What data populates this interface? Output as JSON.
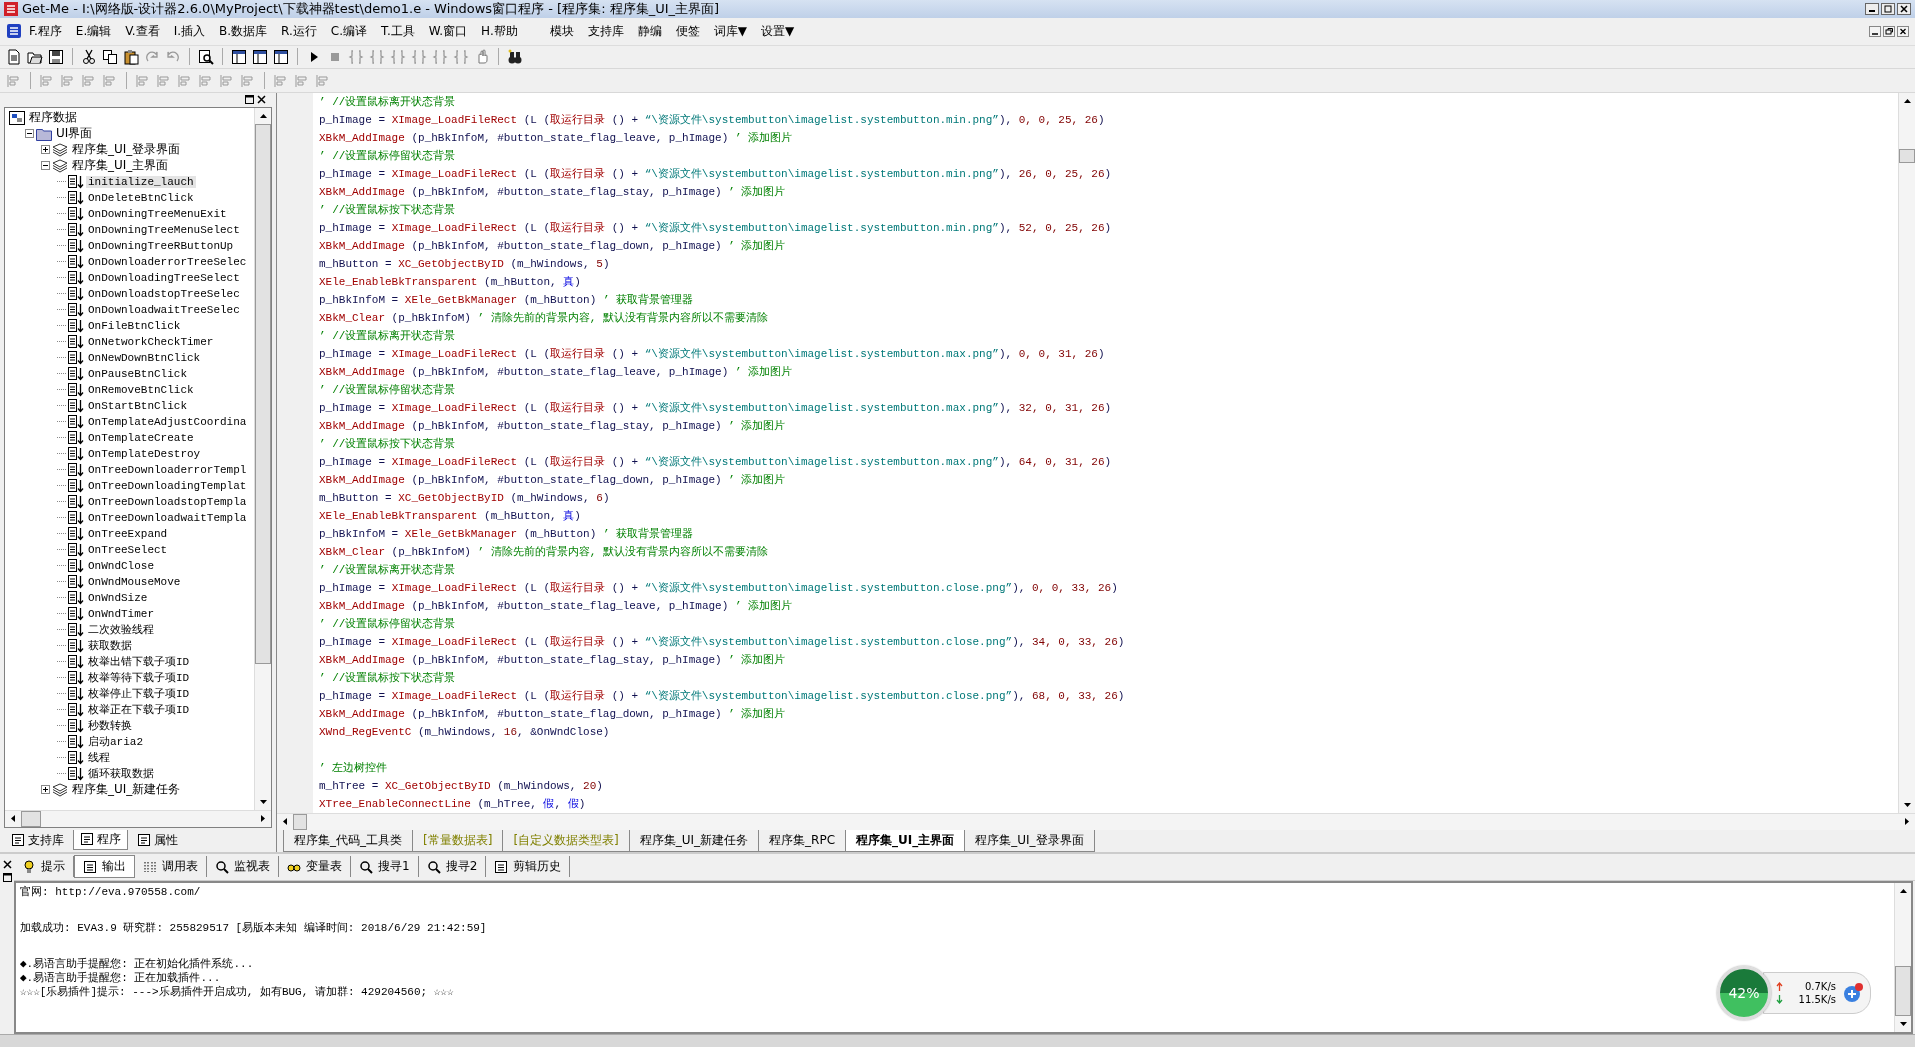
{
  "window": {
    "title": "Get-Me - I:\\网络版-设计器2.6.0\\MyProject\\下载神器test\\demo1.e - Windows窗口程序 - [程序集: 程序集_UI_主界面]"
  },
  "menu": [
    "F.程序",
    "E.编辑",
    "V.查看",
    "I.插入",
    "B.数据库",
    "R.运行",
    "C.编译",
    "T.工具",
    "W.窗口",
    "H.帮助",
    "模块",
    "支持库",
    "静编",
    "便签",
    "词库▼",
    "设置▼"
  ],
  "tree": {
    "root": {
      "label": "程序数据",
      "kind": "root",
      "children": [
        {
          "label": "UI界面",
          "kind": "folder",
          "expanded": true,
          "children": [
            {
              "label": "程序集_UI_登录界面",
              "kind": "module",
              "expanded": false
            },
            {
              "label": "程序集_UI_主界面",
              "kind": "module",
              "expanded": true,
              "children": [
                {
                  "label": "initialize_lauch",
                  "kind": "method",
                  "selected": true
                },
                {
                  "label": "OnDeleteBtnClick",
                  "kind": "method",
                  "selected": false
                },
                {
                  "label": "OnDowningTreeMenuExit",
                  "kind": "method",
                  "selected": false
                },
                {
                  "label": "OnDowningTreeMenuSelect",
                  "kind": "method",
                  "selected": false
                },
                {
                  "label": "OnDowningTreeRButtonUp",
                  "kind": "method",
                  "selected": false
                },
                {
                  "label": "OnDownloaderrorTreeSelec",
                  "kind": "method",
                  "selected": false
                },
                {
                  "label": "OnDownloadingTreeSelect",
                  "kind": "method",
                  "selected": false
                },
                {
                  "label": "OnDownloadstopTreeSelec",
                  "kind": "method",
                  "selected": false
                },
                {
                  "label": "OnDownloadwaitTreeSelec",
                  "kind": "method",
                  "selected": false
                },
                {
                  "label": "OnFileBtnClick",
                  "kind": "method",
                  "selected": false
                },
                {
                  "label": "OnNetworkCheckTimer",
                  "kind": "method",
                  "selected": false
                },
                {
                  "label": "OnNewDownBtnClick",
                  "kind": "method",
                  "selected": false
                },
                {
                  "label": "OnPauseBtnClick",
                  "kind": "method",
                  "selected": false
                },
                {
                  "label": "OnRemoveBtnClick",
                  "kind": "method",
                  "selected": false
                },
                {
                  "label": "OnStartBtnClick",
                  "kind": "method",
                  "selected": false
                },
                {
                  "label": "OnTemplateAdjustCoordina",
                  "kind": "method",
                  "selected": false
                },
                {
                  "label": "OnTemplateCreate",
                  "kind": "method",
                  "selected": false
                },
                {
                  "label": "OnTemplateDestroy",
                  "kind": "method",
                  "selected": false
                },
                {
                  "label": "OnTreeDownloaderrorTempl",
                  "kind": "method",
                  "selected": false
                },
                {
                  "label": "OnTreeDownloadingTemplat",
                  "kind": "method",
                  "selected": false
                },
                {
                  "label": "OnTreeDownloadstopTempla",
                  "kind": "method",
                  "selected": false
                },
                {
                  "label": "OnTreeDownloadwaitTempla",
                  "kind": "method",
                  "selected": false
                },
                {
                  "label": "OnTreeExpand",
                  "kind": "method",
                  "selected": false
                },
                {
                  "label": "OnTreeSelect",
                  "kind": "method",
                  "selected": false
                },
                {
                  "label": "OnWndClose",
                  "kind": "method",
                  "selected": false
                },
                {
                  "label": "OnWndMouseMove",
                  "kind": "method",
                  "selected": false
                },
                {
                  "label": "OnWndSize",
                  "kind": "method",
                  "selected": false
                },
                {
                  "label": "OnWndTimer",
                  "kind": "method",
                  "selected": false
                },
                {
                  "label": "二次效验线程",
                  "kind": "method",
                  "selected": false
                },
                {
                  "label": "获取数据",
                  "kind": "method",
                  "selected": false
                },
                {
                  "label": "枚举出错下载子项ID",
                  "kind": "method",
                  "selected": false
                },
                {
                  "label": "枚举等待下载子项ID",
                  "kind": "method",
                  "selected": false
                },
                {
                  "label": "枚举停止下载子项ID",
                  "kind": "method",
                  "selected": false
                },
                {
                  "label": "枚举正在下载子项ID",
                  "kind": "method",
                  "selected": false
                },
                {
                  "label": "秒数转换",
                  "kind": "method",
                  "selected": false
                },
                {
                  "label": "启动aria2",
                  "kind": "method",
                  "selected": false
                },
                {
                  "label": "线程",
                  "kind": "method",
                  "selected": false
                },
                {
                  "label": "循环获取数据",
                  "kind": "method",
                  "selected": false
                }
              ]
            },
            {
              "label": "程序集_UI_新建任务",
              "kind": "module",
              "expanded": false
            }
          ]
        }
      ]
    }
  },
  "left_tabs": [
    {
      "label": "支持库",
      "selected": false
    },
    {
      "label": "程序",
      "selected": true
    },
    {
      "label": "属性",
      "selected": false
    }
  ],
  "code": [
    {
      "spaced": false,
      "tokens": [
        {
          "kind": "comment",
          "text": "’ //设置鼠标离开状态背景"
        }
      ]
    },
    {
      "spaced": false,
      "tokens": [
        {
          "kind": "plain",
          "text": "p_hImage = "
        },
        {
          "kind": "call",
          "text": "XImage_LoadFileRect"
        },
        {
          "kind": "plain",
          "text": " (L ("
        },
        {
          "kind": "call",
          "text": "取运行目录"
        },
        {
          "kind": "plain",
          "text": " () + "
        },
        {
          "kind": "string",
          "text": "“\\资源文件\\systembutton\\imagelist.systembutton.min.png”"
        },
        {
          "kind": "plain",
          "text": "), "
        },
        {
          "kind": "number",
          "text": "0, 0, 25, 26"
        },
        {
          "kind": "plain",
          "text": ")"
        }
      ]
    },
    {
      "spaced": false,
      "tokens": [
        {
          "kind": "call",
          "text": "XBkM_AddImage"
        },
        {
          "kind": "plain",
          "text": " (p_hBkInfoM, #button_state_flag_leave, p_hImage) "
        },
        {
          "kind": "comment",
          "text": "’ 添加图片"
        }
      ]
    },
    {
      "spaced": false,
      "tokens": [
        {
          "kind": "comment",
          "text": "’ //设置鼠标停留状态背景"
        }
      ]
    },
    {
      "spaced": false,
      "tokens": [
        {
          "kind": "plain",
          "text": "p_hImage = "
        },
        {
          "kind": "call",
          "text": "XImage_LoadFileRect"
        },
        {
          "kind": "plain",
          "text": " (L ("
        },
        {
          "kind": "call",
          "text": "取运行目录"
        },
        {
          "kind": "plain",
          "text": " () + "
        },
        {
          "kind": "string",
          "text": "“\\资源文件\\systembutton\\imagelist.systembutton.min.png”"
        },
        {
          "kind": "plain",
          "text": "), "
        },
        {
          "kind": "number",
          "text": "26, 0, 25, 26"
        },
        {
          "kind": "plain",
          "text": ")"
        }
      ]
    },
    {
      "spaced": false,
      "tokens": [
        {
          "kind": "call",
          "text": "XBkM_AddImage"
        },
        {
          "kind": "plain",
          "text": " (p_hBkInfoM, #button_state_flag_stay, p_hImage) "
        },
        {
          "kind": "comment",
          "text": "’ 添加图片"
        }
      ]
    },
    {
      "spaced": false,
      "tokens": [
        {
          "kind": "comment",
          "text": "’ //设置鼠标按下状态背景"
        }
      ]
    },
    {
      "spaced": false,
      "tokens": [
        {
          "kind": "plain",
          "text": "p_hImage = "
        },
        {
          "kind": "call",
          "text": "XImage_LoadFileRect"
        },
        {
          "kind": "plain",
          "text": " (L ("
        },
        {
          "kind": "call",
          "text": "取运行目录"
        },
        {
          "kind": "plain",
          "text": " () + "
        },
        {
          "kind": "string",
          "text": "“\\资源文件\\systembutton\\imagelist.systembutton.min.png”"
        },
        {
          "kind": "plain",
          "text": "), "
        },
        {
          "kind": "number",
          "text": "52, 0, 25, 26"
        },
        {
          "kind": "plain",
          "text": ")"
        }
      ]
    },
    {
      "spaced": false,
      "tokens": [
        {
          "kind": "call",
          "text": "XBkM_AddImage"
        },
        {
          "kind": "plain",
          "text": " (p_hBkInfoM, #button_state_flag_down, p_hImage) "
        },
        {
          "kind": "comment",
          "text": "’ 添加图片"
        }
      ]
    },
    {
      "spaced": false,
      "tokens": [
        {
          "kind": "plain",
          "text": "m_hButton = "
        },
        {
          "kind": "call",
          "text": "XC_GetObjectByID"
        },
        {
          "kind": "plain",
          "text": " (m_hWindows, "
        },
        {
          "kind": "number",
          "text": "5"
        },
        {
          "kind": "plain",
          "text": ")"
        }
      ]
    },
    {
      "spaced": false,
      "tokens": [
        {
          "kind": "call",
          "text": "XEle_EnableBkTransparent"
        },
        {
          "kind": "plain",
          "text": " (m_hButton, "
        },
        {
          "kind": "boolean",
          "text": "真"
        },
        {
          "kind": "plain",
          "text": ")"
        }
      ]
    },
    {
      "spaced": false,
      "tokens": [
        {
          "kind": "plain",
          "text": "p_hBkInfoM = "
        },
        {
          "kind": "call",
          "text": "XEle_GetBkManager"
        },
        {
          "kind": "plain",
          "text": " (m_hButton) "
        },
        {
          "kind": "comment",
          "text": "’ 获取背景管理器"
        }
      ]
    },
    {
      "spaced": false,
      "tokens": [
        {
          "kind": "call",
          "text": "XBkM_Clear"
        },
        {
          "kind": "plain",
          "text": " (p_hBkInfoM) "
        },
        {
          "kind": "comment",
          "text": "’ 清除先前的背景内容, 默认没有背景内容所以不需要清除"
        }
      ]
    },
    {
      "spaced": false,
      "tokens": [
        {
          "kind": "comment",
          "text": "’ //设置鼠标离开状态背景"
        }
      ]
    },
    {
      "spaced": false,
      "tokens": [
        {
          "kind": "plain",
          "text": "p_hImage = "
        },
        {
          "kind": "call",
          "text": "XImage_LoadFileRect"
        },
        {
          "kind": "plain",
          "text": " (L ("
        },
        {
          "kind": "call",
          "text": "取运行目录"
        },
        {
          "kind": "plain",
          "text": " () + "
        },
        {
          "kind": "string",
          "text": "“\\资源文件\\systembutton\\imagelist.systembutton.max.png”"
        },
        {
          "kind": "plain",
          "text": "), "
        },
        {
          "kind": "number",
          "text": "0, 0, 31, 26"
        },
        {
          "kind": "plain",
          "text": ")"
        }
      ]
    },
    {
      "spaced": false,
      "tokens": [
        {
          "kind": "call",
          "text": "XBkM_AddImage"
        },
        {
          "kind": "plain",
          "text": " (p_hBkInfoM, #button_state_flag_leave, p_hImage) "
        },
        {
          "kind": "comment",
          "text": "’ 添加图片"
        }
      ]
    },
    {
      "spaced": false,
      "tokens": [
        {
          "kind": "comment",
          "text": "’ //设置鼠标停留状态背景"
        }
      ]
    },
    {
      "spaced": false,
      "tokens": [
        {
          "kind": "plain",
          "text": "p_hImage = "
        },
        {
          "kind": "call",
          "text": "XImage_LoadFileRect"
        },
        {
          "kind": "plain",
          "text": " (L ("
        },
        {
          "kind": "call",
          "text": "取运行目录"
        },
        {
          "kind": "plain",
          "text": " () + "
        },
        {
          "kind": "string",
          "text": "“\\资源文件\\systembutton\\imagelist.systembutton.max.png”"
        },
        {
          "kind": "plain",
          "text": "), "
        },
        {
          "kind": "number",
          "text": "32, 0, 31, 26"
        },
        {
          "kind": "plain",
          "text": ")"
        }
      ]
    },
    {
      "spaced": false,
      "tokens": [
        {
          "kind": "call",
          "text": "XBkM_AddImage"
        },
        {
          "kind": "plain",
          "text": " (p_hBkInfoM, #button_state_flag_stay, p_hImage) "
        },
        {
          "kind": "comment",
          "text": "’ 添加图片"
        }
      ]
    },
    {
      "spaced": false,
      "tokens": [
        {
          "kind": "comment",
          "text": "’ //设置鼠标按下状态背景"
        }
      ]
    },
    {
      "spaced": false,
      "tokens": [
        {
          "kind": "plain",
          "text": "p_hImage = "
        },
        {
          "kind": "call",
          "text": "XImage_LoadFileRect"
        },
        {
          "kind": "plain",
          "text": " (L ("
        },
        {
          "kind": "call",
          "text": "取运行目录"
        },
        {
          "kind": "plain",
          "text": " () + "
        },
        {
          "kind": "string",
          "text": "“\\资源文件\\systembutton\\imagelist.systembutton.max.png”"
        },
        {
          "kind": "plain",
          "text": "), "
        },
        {
          "kind": "number",
          "text": "64, 0, 31, 26"
        },
        {
          "kind": "plain",
          "text": ")"
        }
      ]
    },
    {
      "spaced": false,
      "tokens": [
        {
          "kind": "call",
          "text": "XBkM_AddImage"
        },
        {
          "kind": "plain",
          "text": " (p_hBkInfoM, #button_state_flag_down, p_hImage) "
        },
        {
          "kind": "comment",
          "text": "’ 添加图片"
        }
      ]
    },
    {
      "spaced": false,
      "tokens": [
        {
          "kind": "plain",
          "text": "m_hButton = "
        },
        {
          "kind": "call",
          "text": "XC_GetObjectByID"
        },
        {
          "kind": "plain",
          "text": " (m_hWindows, "
        },
        {
          "kind": "number",
          "text": "6"
        },
        {
          "kind": "plain",
          "text": ")"
        }
      ]
    },
    {
      "spaced": false,
      "tokens": [
        {
          "kind": "call",
          "text": "XEle_EnableBkTransparent"
        },
        {
          "kind": "plain",
          "text": " (m_hButton, "
        },
        {
          "kind": "boolean",
          "text": "真"
        },
        {
          "kind": "plain",
          "text": ")"
        }
      ]
    },
    {
      "spaced": false,
      "tokens": [
        {
          "kind": "plain",
          "text": "p_hBkInfoM = "
        },
        {
          "kind": "call",
          "text": "XEle_GetBkManager"
        },
        {
          "kind": "plain",
          "text": " (m_hButton) "
        },
        {
          "kind": "comment",
          "text": "’ 获取背景管理器"
        }
      ]
    },
    {
      "spaced": false,
      "tokens": [
        {
          "kind": "call",
          "text": "XBkM_Clear"
        },
        {
          "kind": "plain",
          "text": " (p_hBkInfoM) "
        },
        {
          "kind": "comment",
          "text": "’ 清除先前的背景内容, 默认没有背景内容所以不需要清除"
        }
      ]
    },
    {
      "spaced": false,
      "tokens": [
        {
          "kind": "comment",
          "text": "’ //设置鼠标离开状态背景"
        }
      ]
    },
    {
      "spaced": false,
      "tokens": [
        {
          "kind": "plain",
          "text": "p_hImage = "
        },
        {
          "kind": "call",
          "text": "XImage_LoadFileRect"
        },
        {
          "kind": "plain",
          "text": " (L ("
        },
        {
          "kind": "call",
          "text": "取运行目录"
        },
        {
          "kind": "plain",
          "text": " () + "
        },
        {
          "kind": "string",
          "text": "“\\资源文件\\systembutton\\imagelist.systembutton.close.png”"
        },
        {
          "kind": "plain",
          "text": "), "
        },
        {
          "kind": "number",
          "text": "0, 0, 33, 26"
        },
        {
          "kind": "plain",
          "text": ")"
        }
      ]
    },
    {
      "spaced": false,
      "tokens": [
        {
          "kind": "call",
          "text": "XBkM_AddImage"
        },
        {
          "kind": "plain",
          "text": " (p_hBkInfoM, #button_state_flag_leave, p_hImage) "
        },
        {
          "kind": "comment",
          "text": "’ 添加图片"
        }
      ]
    },
    {
      "spaced": false,
      "tokens": [
        {
          "kind": "comment",
          "text": "’ //设置鼠标停留状态背景"
        }
      ]
    },
    {
      "spaced": false,
      "tokens": [
        {
          "kind": "plain",
          "text": "p_hImage = "
        },
        {
          "kind": "call",
          "text": "XImage_LoadFileRect"
        },
        {
          "kind": "plain",
          "text": " (L ("
        },
        {
          "kind": "call",
          "text": "取运行目录"
        },
        {
          "kind": "plain",
          "text": " () + "
        },
        {
          "kind": "string",
          "text": "“\\资源文件\\systembutton\\imagelist.systembutton.close.png”"
        },
        {
          "kind": "plain",
          "text": "), "
        },
        {
          "kind": "number",
          "text": "34, 0, 33, 26"
        },
        {
          "kind": "plain",
          "text": ")"
        }
      ]
    },
    {
      "spaced": false,
      "tokens": [
        {
          "kind": "call",
          "text": "XBkM_AddImage"
        },
        {
          "kind": "plain",
          "text": " (p_hBkInfoM, #button_state_flag_stay, p_hImage) "
        },
        {
          "kind": "comment",
          "text": "’ 添加图片"
        }
      ]
    },
    {
      "spaced": false,
      "tokens": [
        {
          "kind": "comment",
          "text": "’ //设置鼠标按下状态背景"
        }
      ]
    },
    {
      "spaced": false,
      "tokens": [
        {
          "kind": "plain",
          "text": "p_hImage = "
        },
        {
          "kind": "call",
          "text": "XImage_LoadFileRect"
        },
        {
          "kind": "plain",
          "text": " (L ("
        },
        {
          "kind": "call",
          "text": "取运行目录"
        },
        {
          "kind": "plain",
          "text": " () + "
        },
        {
          "kind": "string",
          "text": "“\\资源文件\\systembutton\\imagelist.systembutton.close.png”"
        },
        {
          "kind": "plain",
          "text": "), "
        },
        {
          "kind": "number",
          "text": "68, 0, 33, 26"
        },
        {
          "kind": "plain",
          "text": ")"
        }
      ]
    },
    {
      "spaced": false,
      "tokens": [
        {
          "kind": "call",
          "text": "XBkM_AddImage"
        },
        {
          "kind": "plain",
          "text": " (p_hBkInfoM, #button_state_flag_down, p_hImage) "
        },
        {
          "kind": "comment",
          "text": "’ 添加图片"
        }
      ]
    },
    {
      "spaced": false,
      "tokens": [
        {
          "kind": "call",
          "text": "XWnd_RegEventC"
        },
        {
          "kind": "plain",
          "text": " (m_hWindows, "
        },
        {
          "kind": "number",
          "text": "16"
        },
        {
          "kind": "plain",
          "text": ", &OnWndClose)"
        }
      ]
    },
    {
      "spaced": true,
      "tokens": [
        {
          "kind": "comment",
          "text": "’ 左边树控件"
        }
      ]
    },
    {
      "spaced": false,
      "tokens": [
        {
          "kind": "plain",
          "text": "m_hTree = "
        },
        {
          "kind": "call",
          "text": "XC_GetObjectByID"
        },
        {
          "kind": "plain",
          "text": " (m_hWindows, "
        },
        {
          "kind": "number",
          "text": "20"
        },
        {
          "kind": "plain",
          "text": ")"
        }
      ]
    },
    {
      "spaced": false,
      "tokens": [
        {
          "kind": "call",
          "text": "XTree_EnableConnectLine"
        },
        {
          "kind": "plain",
          "text": " (m_hTree, "
        },
        {
          "kind": "boolean",
          "text": "假"
        },
        {
          "kind": "plain",
          "text": ", "
        },
        {
          "kind": "boolean",
          "text": "假"
        },
        {
          "kind": "plain",
          "text": ")"
        }
      ]
    }
  ],
  "editor_tabs": [
    {
      "label": "程序集_代码_工具类",
      "kind": "module",
      "selected": false
    },
    {
      "label": "[常量数据表]",
      "kind": "table",
      "selected": false
    },
    {
      "label": "[自定义数据类型表]",
      "kind": "table",
      "selected": false
    },
    {
      "label": "程序集_UI_新建任务",
      "kind": "module",
      "selected": false
    },
    {
      "label": "程序集_RPC",
      "kind": "module",
      "selected": false
    },
    {
      "label": "程序集_UI_主界面",
      "kind": "module",
      "selected": true
    },
    {
      "label": "程序集_UI_登录界面",
      "kind": "module",
      "selected": false
    }
  ],
  "bottom_tabs": [
    {
      "label": "提示",
      "selected": false
    },
    {
      "label": "输出",
      "selected": true
    },
    {
      "label": "调用表",
      "selected": false
    },
    {
      "label": "监视表",
      "selected": false
    },
    {
      "label": "变量表",
      "selected": false
    },
    {
      "label": "搜寻1",
      "selected": false
    },
    {
      "label": "搜寻2",
      "selected": false
    },
    {
      "label": "剪辑历史",
      "selected": false
    }
  ],
  "output": [
    {
      "text": "官网: http://eva.970558.com/",
      "spaced": false
    },
    {
      "text": "加载成功: EVA3.9 研究群: 255829517 [易版本未知 编译时间: 2018/6/29 21:42:59]",
      "spaced": true
    },
    {
      "text": "◆.易语言助手提醒您: 正在初始化插件系统...",
      "spaced": true
    },
    {
      "text": "◆.易语言助手提醒您: 正在加载插件...",
      "spaced": false
    },
    {
      "text": "☆☆☆[乐易插件]提示: --->乐易插件开启成功, 如有BUG, 请加群: 429204560; ☆☆☆",
      "spaced": false
    }
  ],
  "net_monitor": {
    "percent": "42%",
    "upload": "0.7K/s",
    "download": "11.5K/s"
  }
}
